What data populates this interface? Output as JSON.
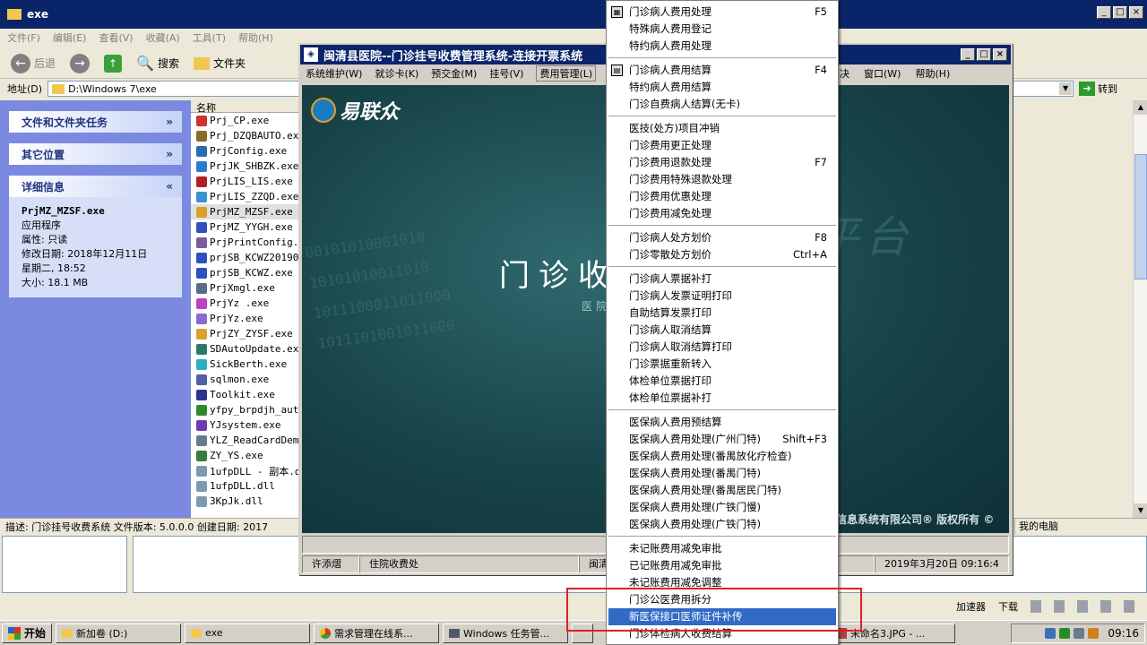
{
  "explorer": {
    "title": "exe",
    "menu": [
      "文件(F)",
      "编辑(E)",
      "查看(V)",
      "收藏(A)",
      "工具(T)",
      "帮助(H)"
    ],
    "toolbar": {
      "back": "后退",
      "search": "搜索",
      "folders": "文件夹"
    },
    "address_label": "地址(D)",
    "address_value": "D:\\Windows 7\\exe",
    "goto_label": "转到",
    "tasks_panel": "文件和文件夹任务",
    "other_panel": "其它位置",
    "details_panel": "详细信息",
    "details": {
      "file_name": "PrjMZ_MZSF.exe",
      "type": "应用程序",
      "attr": "属性: 只读",
      "modified_label": "修改日期: 2018年12月11日",
      "modified_time": "星期二, 18:52",
      "size": "大小: 18.1 MB"
    },
    "column_name": "名称",
    "files": [
      "Prj_CP.exe",
      "Prj_DZQBAUTO.exe",
      "PrjConfig.exe",
      "PrjJK_SHBZK.exe",
      "PrjLIS_LIS.exe",
      "PrjLIS_ZZQD.exe",
      "PrjMZ_MZSF.exe",
      "PrjMZ_YYGH.exe",
      "PrjPrintConfig.exe",
      "prjSB_KCWZ201901",
      "prjSB_KCWZ.exe",
      "PrjXmgl.exe",
      "PrjYz .exe",
      "PrjYz.exe",
      "PrjZY_ZYSF.exe",
      "SDAutoUpdate.exe",
      "SickBerth.exe",
      "sqlmon.exe",
      "Toolkit.exe",
      "yfpy_brpdjh_auto",
      "YJsystem.exe",
      "YLZ_ReadCardDemo",
      "ZY_YS.exe",
      "1ufpDLL - 副本.d",
      "1ufpDLL.dll",
      "3KpJk.dll"
    ],
    "file_colors": [
      "#d03030",
      "#8a6a2a",
      "#2a6ab0",
      "#2a7ad0",
      "#b02020",
      "#3a90d0",
      "#d8a030",
      "#3050c0",
      "#7a5aa0",
      "#3050c0",
      "#3050c0",
      "#5a6a8a",
      "#c040c0",
      "#8a6ad0",
      "#d8a030",
      "#2a7a6a",
      "#2ab0c0",
      "#5060a0",
      "#303090",
      "#2a8a2a",
      "#6a3ab0",
      "#6a7a8a",
      "#3a7a3a",
      "#8098b0",
      "#8098b0",
      "#8098b0"
    ],
    "status_text": "描述: 门诊挂号收费系统 文件版本: 5.0.0.0 创建日期: 2017",
    "status_right": "我的电脑"
  },
  "his": {
    "title": "闽清县医院--门诊挂号收费管理系统-连接开票系统",
    "menus": [
      "系统维护(W)",
      "就诊卡(K)",
      "预交金(M)",
      "挂号(V)",
      "费用管理(L)"
    ],
    "right_menus": [
      "决",
      "窗口(W)",
      "帮助(H)"
    ],
    "logo": "易联众",
    "banner_title": "门诊收",
    "banner_sub": "医院",
    "banner_bg": "息平台",
    "banner_nums": [
      "00101010001010",
      "10101010011010",
      "1011100011011000",
      "1011101001011000"
    ],
    "copyright": "信息系统有限公司® 版权所有 ©",
    "status": {
      "user": "许添熠",
      "dept": "住院收费处",
      "hosp": "闽清",
      "time": "2019年3月20日 09:16:4"
    }
  },
  "dropdown": {
    "groups": [
      [
        {
          "label": "门诊病人费用处理",
          "shortcut": "F5",
          "icon": "grid-icon"
        },
        {
          "label": "特殊病人费用登记"
        },
        {
          "label": "特约病人费用处理"
        }
      ],
      [
        {
          "label": "门诊病人费用结算",
          "shortcut": "F4",
          "icon": "calc-icon"
        },
        {
          "label": "特约病人费用结算"
        },
        {
          "label": "门诊自费病人结算(无卡)"
        }
      ],
      [
        {
          "label": "医技(处方)项目冲销"
        },
        {
          "label": "门诊费用更正处理"
        },
        {
          "label": "门诊费用退款处理",
          "shortcut": "F7"
        },
        {
          "label": "门诊费用特殊退款处理"
        },
        {
          "label": "门诊费用优惠处理"
        },
        {
          "label": "门诊费用减免处理"
        }
      ],
      [
        {
          "label": "门诊病人处方划价",
          "shortcut": "F8"
        },
        {
          "label": "门诊零散处方划价",
          "shortcut": "Ctrl+A"
        }
      ],
      [
        {
          "label": "门诊病人票据补打"
        },
        {
          "label": "门诊病人发票证明打印"
        },
        {
          "label": "自助结算发票打印"
        },
        {
          "label": "门诊病人取消结算"
        },
        {
          "label": "门诊病人取消结算打印"
        },
        {
          "label": "门诊票据重新转入"
        },
        {
          "label": "体检单位票据打印"
        },
        {
          "label": "体检单位票据补打"
        }
      ],
      [
        {
          "label": "医保病人费用预结算"
        },
        {
          "label": "医保病人费用处理(广州门特)",
          "shortcut": "Shift+F3"
        },
        {
          "label": "医保病人费用处理(番禺放化疗检查)"
        },
        {
          "label": "医保病人费用处理(番禺门特)"
        },
        {
          "label": "医保病人费用处理(番禺居民门特)"
        },
        {
          "label": "医保病人费用处理(广铁门慢)"
        },
        {
          "label": "医保病人费用处理(广铁门特)"
        }
      ],
      [
        {
          "label": "未记账费用减免审批"
        },
        {
          "label": "已记账费用减免审批"
        },
        {
          "label": "未记账费用减免调整"
        },
        {
          "label": "门诊公医费用拆分"
        },
        {
          "label": "新医保接口医师证件补传",
          "highlight": true
        },
        {
          "label": "门诊体检病人收费结算"
        }
      ]
    ]
  },
  "accel": {
    "label1": "加速器",
    "label2": "下载"
  },
  "taskbar": {
    "start": "开始",
    "tasks": [
      "新加卷 (D:)",
      "exe",
      "需求管理在线系...",
      "Windows 任务管...",
      "",
      "未命名3.JPG - ..."
    ],
    "clock": "09:16"
  }
}
